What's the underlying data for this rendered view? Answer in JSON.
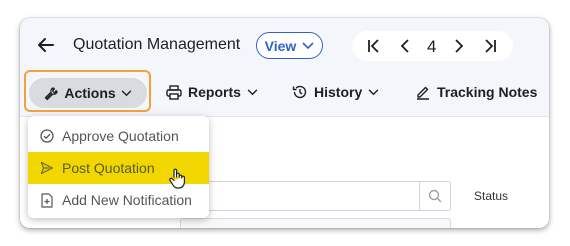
{
  "header": {
    "title": "Quotation Management",
    "view_label": "View",
    "page_number": "4"
  },
  "toolbar": {
    "actions_label": "Actions",
    "reports_label": "Reports",
    "history_label": "History",
    "tracking_label": "Tracking Notes"
  },
  "actions_menu": {
    "items": [
      {
        "label": "Approve Quotation",
        "icon": "check-circle-icon"
      },
      {
        "label": "Post Quotation",
        "icon": "send-icon",
        "highlighted": true
      },
      {
        "label": "Add New Notification",
        "icon": "add-document-icon"
      }
    ]
  },
  "content": {
    "status_label": "Status"
  },
  "colors": {
    "accent": "#2f63c9",
    "highlight": "#f1d600",
    "focus_outline": "#f2a23c"
  }
}
